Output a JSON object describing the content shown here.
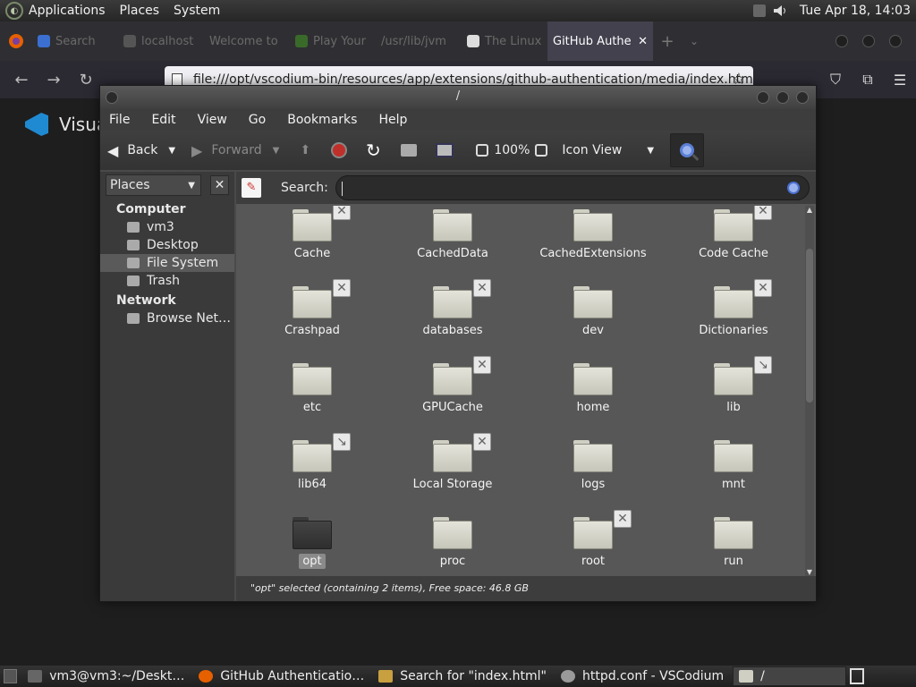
{
  "top_panel": {
    "menus": [
      "Applications",
      "Places",
      "System"
    ],
    "clock": "Tue Apr 18, 14:03"
  },
  "browser": {
    "tabs": [
      {
        "label": "Search"
      },
      {
        "label": "localhost"
      },
      {
        "label": "Welcome to"
      },
      {
        "label": "Play Your"
      },
      {
        "label": "/usr/lib/jvm"
      },
      {
        "label": "The Linux"
      },
      {
        "label": "GitHub Authe"
      }
    ],
    "url": "file:///opt/vscodium-bin/resources/app/extensions/github-authentication/media/index.html"
  },
  "page": {
    "heading": "Visua"
  },
  "file_manager": {
    "title": "/",
    "menu": [
      "File",
      "Edit",
      "View",
      "Go",
      "Bookmarks",
      "Help"
    ],
    "toolbar": {
      "back": "Back",
      "forward": "Forward",
      "zoom": "100%",
      "view_mode": "Icon View"
    },
    "sidebar": {
      "selector": "Places",
      "sections": [
        {
          "title": "Computer",
          "items": [
            {
              "label": "vm3"
            },
            {
              "label": "Desktop"
            },
            {
              "label": "File System",
              "selected": true
            },
            {
              "label": "Trash"
            }
          ]
        },
        {
          "title": "Network",
          "items": [
            {
              "label": "Browse Net…"
            }
          ]
        }
      ]
    },
    "search": {
      "label": "Search:",
      "value": ""
    },
    "items": [
      {
        "name": "Cache",
        "emblem": "x"
      },
      {
        "name": "CachedData",
        "emblem": ""
      },
      {
        "name": "CachedExtensions",
        "emblem": ""
      },
      {
        "name": "Code Cache",
        "emblem": "x"
      },
      {
        "name": "Crashpad",
        "emblem": "x"
      },
      {
        "name": "databases",
        "emblem": "x"
      },
      {
        "name": "dev",
        "emblem": ""
      },
      {
        "name": "Dictionaries",
        "emblem": "x"
      },
      {
        "name": "etc",
        "emblem": ""
      },
      {
        "name": "GPUCache",
        "emblem": "x"
      },
      {
        "name": "home",
        "emblem": ""
      },
      {
        "name": "lib",
        "emblem": "link"
      },
      {
        "name": "lib64",
        "emblem": "link"
      },
      {
        "name": "Local Storage",
        "emblem": "x"
      },
      {
        "name": "logs",
        "emblem": ""
      },
      {
        "name": "mnt",
        "emblem": ""
      },
      {
        "name": "opt",
        "emblem": "",
        "selected": true
      },
      {
        "name": "proc",
        "emblem": ""
      },
      {
        "name": "root",
        "emblem": "x"
      },
      {
        "name": "run",
        "emblem": ""
      }
    ],
    "status": "\"opt\" selected (containing 2 items), Free space: 46.8 GB"
  },
  "taskbar": {
    "tasks": [
      {
        "label": "vm3@vm3:~/Deskt…",
        "color": "#666666"
      },
      {
        "label": "GitHub Authenticatio…",
        "color": "#e66000"
      },
      {
        "label": "Search for \"index.html\"",
        "color": "#c8a040"
      },
      {
        "label": "httpd.conf - VSCodium",
        "color": "#9a9a9a"
      },
      {
        "label": "/",
        "color": "#cfcfc3"
      }
    ]
  }
}
